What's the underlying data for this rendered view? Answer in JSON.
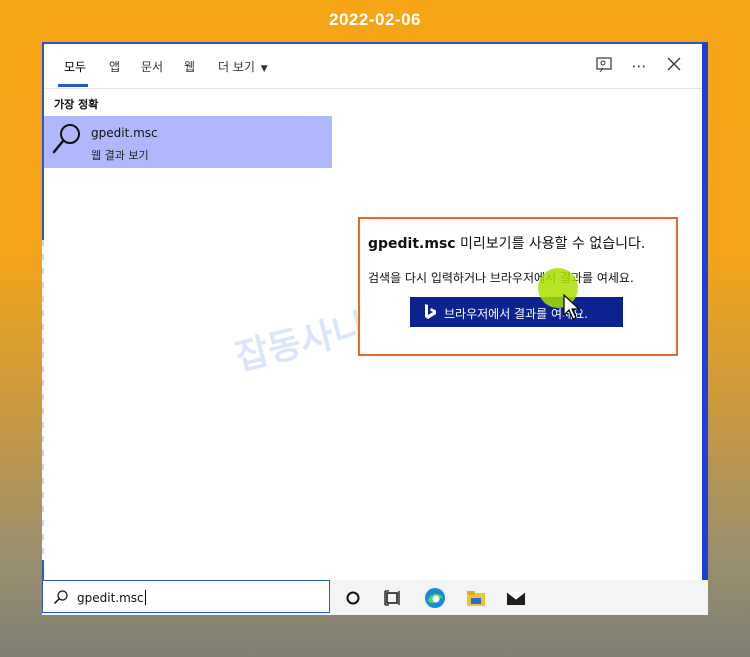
{
  "caption": {
    "date": "2022-02-06"
  },
  "tabs": [
    {
      "label": "모두",
      "active": true
    },
    {
      "label": "앱"
    },
    {
      "label": "문서"
    },
    {
      "label": "웹"
    },
    {
      "label": "더 보기"
    }
  ],
  "header_icons": [
    "feedback-icon",
    "more-icon",
    "close-icon"
  ],
  "best_match": {
    "section_title": "가장 정확",
    "title": "gpedit.msc",
    "subtitle": "웹 결과 보기"
  },
  "preview": {
    "bold_title": "gpedit.msc",
    "title_rest": "미리보기를 사용할 수 없습니다.",
    "message": "검색을 다시 입력하거나 브라우저에서 결과를 여세요.",
    "button_label": "브라우저에서 결과를 여세요."
  },
  "watermark": "잡동사니 블로그",
  "search": {
    "value": "gpedit.msc"
  },
  "taskbar_icons": [
    "cortana-circle-icon",
    "task-view-icon",
    "edge-icon",
    "file-explorer-icon",
    "mail-icon"
  ],
  "colors": {
    "accent": "#2b59c3",
    "selection": "#aeb8fb",
    "bing_button": "#0b2290",
    "highlight_border": "#e06b2a"
  }
}
